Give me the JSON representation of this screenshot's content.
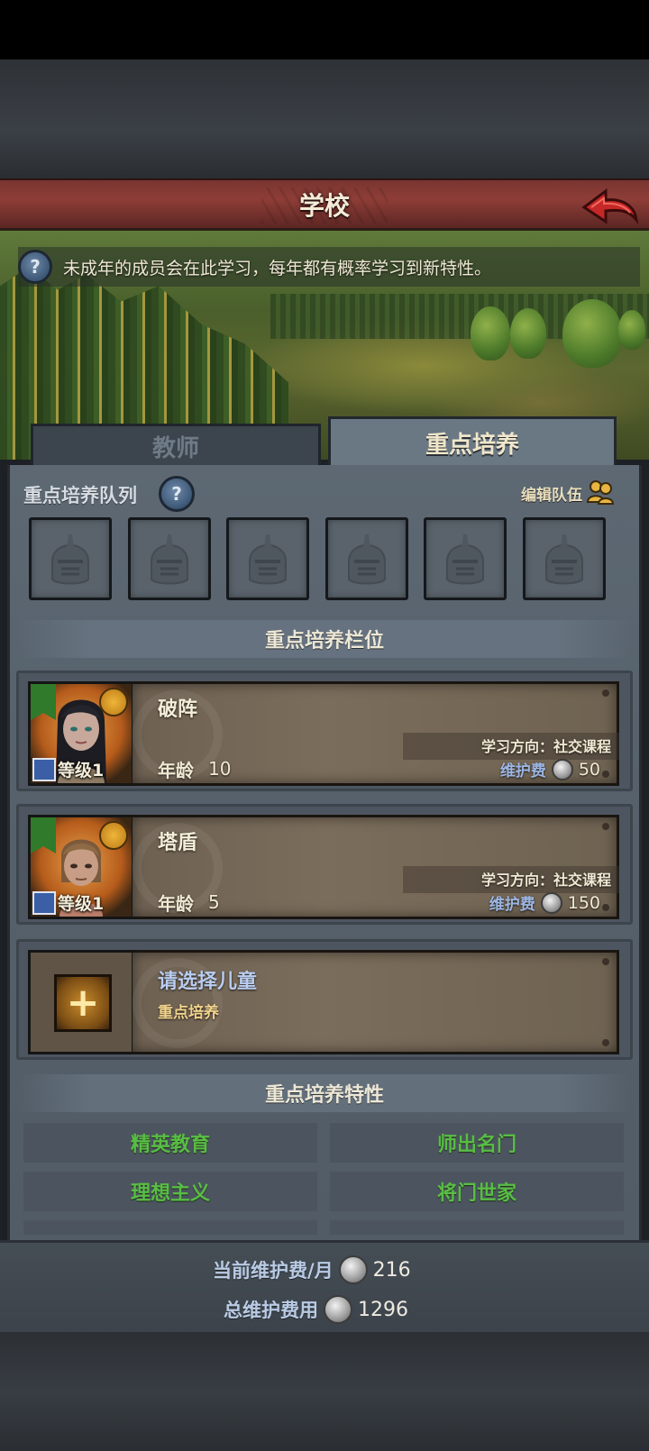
{
  "header": {
    "title": "学校"
  },
  "banner": {
    "info_text": "未成年的成员会在此学习，每年都有概率学习到新特性。"
  },
  "tabs": [
    {
      "label": "教师",
      "active": false
    },
    {
      "label": "重点培养",
      "active": true
    }
  ],
  "queue": {
    "label": "重点培养队列",
    "edit_label": "编辑队伍",
    "slot_count": 6
  },
  "slots_section": {
    "label": "重点培养栏位"
  },
  "children": [
    {
      "name": "破阵",
      "level_label": "等级1",
      "age_label": "年龄",
      "age": "10",
      "direction": "学习方向：社交课程",
      "fee_label": "维护费",
      "fee": "50"
    },
    {
      "name": "塔盾",
      "level_label": "等级1",
      "age_label": "年龄",
      "age": "5",
      "direction": "学习方向：社交课程",
      "fee_label": "维护费",
      "fee": "150"
    }
  ],
  "empty_slot": {
    "title": "请选择儿童",
    "subtitle": "重点培养"
  },
  "traits_section": {
    "label": "重点培养特性",
    "traits": [
      "精英教育",
      "师出名门",
      "理想主义",
      "将门世家"
    ]
  },
  "summary": {
    "monthly_label": "当前维护费/月",
    "monthly_value": "216",
    "total_label": "总维护费用",
    "total_value": "1296"
  },
  "colors": {
    "title_bar": "#8e3d36",
    "trait_text": "#59bd45",
    "fee_label": "#9cb6e3",
    "select_title": "#b9cdf0"
  }
}
